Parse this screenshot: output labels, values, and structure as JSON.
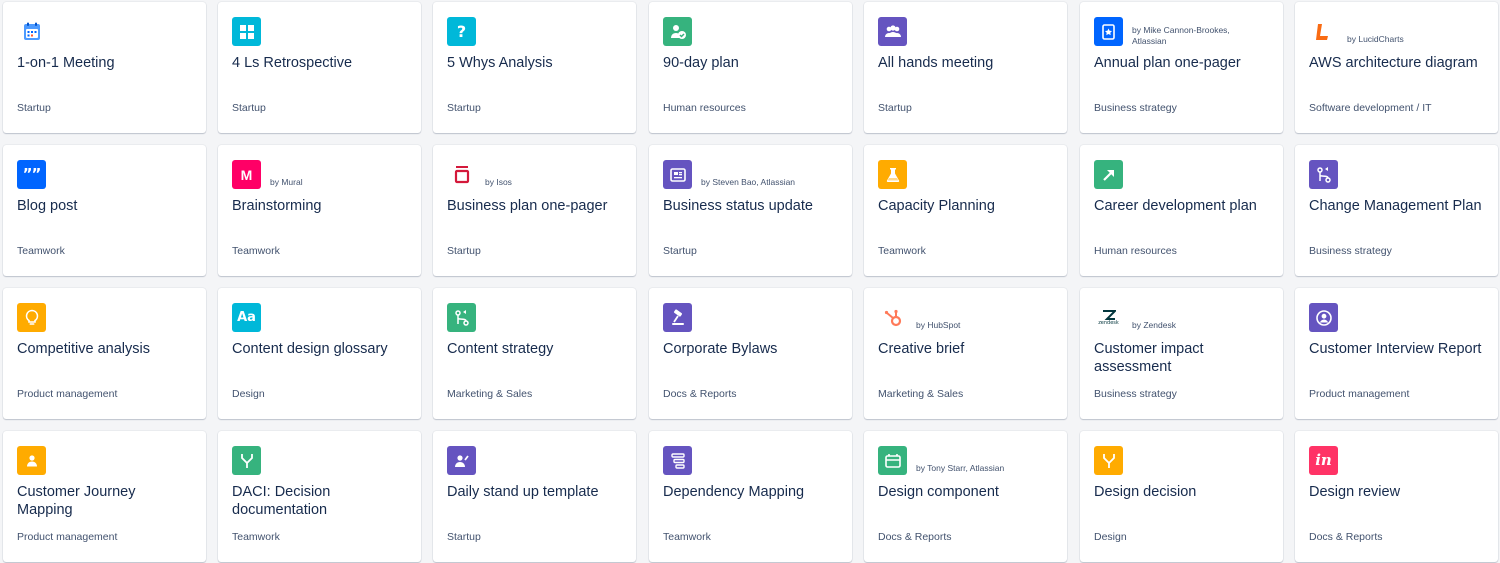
{
  "templates": [
    {
      "title": "1-on-1 Meeting",
      "category": "Startup",
      "icon": "calendar-icon",
      "color": "#ffffff",
      "author": ""
    },
    {
      "title": "4 Ls Retrospective",
      "category": "Startup",
      "icon": "grid-icon",
      "color": "#00b8d9",
      "author": ""
    },
    {
      "title": "5 Whys Analysis",
      "category": "Startup",
      "icon": "question-icon",
      "color": "#00b8d9",
      "author": ""
    },
    {
      "title": "90-day plan",
      "category": "Human resources",
      "icon": "person-check-icon",
      "color": "#36b37e",
      "author": ""
    },
    {
      "title": "All hands meeting",
      "category": "Startup",
      "icon": "people-icon",
      "color": "#6554c0",
      "author": ""
    },
    {
      "title": "Annual plan one-pager",
      "category": "Business strategy",
      "icon": "star-doc-icon",
      "color": "#0065ff",
      "author": "by Mike Cannon-Brookes, Atlassian"
    },
    {
      "title": "AWS architecture diagram",
      "category": "Software development / IT",
      "icon": "lucidcharts-logo-icon",
      "color": "#ffffff",
      "author": "by LucidCharts"
    },
    {
      "title": "Blog post",
      "category": "Teamwork",
      "icon": "quote-icon",
      "color": "#0065ff",
      "author": ""
    },
    {
      "title": "Brainstorming",
      "category": "Teamwork",
      "icon": "mural-logo-icon",
      "color": "#ff0066",
      "author": "by Mural"
    },
    {
      "title": "Business plan one-pager",
      "category": "Startup",
      "icon": "isos-logo-icon",
      "color": "#ffffff",
      "author": "by Isos"
    },
    {
      "title": "Business status update",
      "category": "Startup",
      "icon": "newspaper-icon",
      "color": "#6554c0",
      "author": "by Steven Bao, Atlassian"
    },
    {
      "title": "Capacity Planning",
      "category": "Teamwork",
      "icon": "flask-icon",
      "color": "#ffab00",
      "author": ""
    },
    {
      "title": "Career development plan",
      "category": "Human resources",
      "icon": "arrow-up-right-icon",
      "color": "#36b37e",
      "author": ""
    },
    {
      "title": "Change Management Plan",
      "category": "Business strategy",
      "icon": "branch-icon",
      "color": "#6554c0",
      "author": ""
    },
    {
      "title": "Competitive analysis",
      "category": "Product management",
      "icon": "lightbulb-icon",
      "color": "#ffab00",
      "author": ""
    },
    {
      "title": "Content design glossary",
      "category": "Design",
      "icon": "font-aa-icon",
      "color": "#00b8d9",
      "author": ""
    },
    {
      "title": "Content strategy",
      "category": "Marketing & Sales",
      "icon": "branch-icon",
      "color": "#36b37e",
      "author": ""
    },
    {
      "title": "Corporate Bylaws",
      "category": "Docs & Reports",
      "icon": "gavel-icon",
      "color": "#6554c0",
      "author": ""
    },
    {
      "title": "Creative brief",
      "category": "Marketing & Sales",
      "icon": "hubspot-logo-icon",
      "color": "#ffffff",
      "author": "by HubSpot"
    },
    {
      "title": "Customer impact assessment",
      "category": "Business strategy",
      "icon": "zendesk-logo-icon",
      "color": "#ffffff",
      "author": "by Zendesk"
    },
    {
      "title": "Customer Interview Report",
      "category": "Product management",
      "icon": "user-circle-icon",
      "color": "#6554c0",
      "author": ""
    },
    {
      "title": "Customer Journey Mapping",
      "category": "Product management",
      "icon": "person-icon",
      "color": "#ffab00",
      "author": ""
    },
    {
      "title": "DACI: Decision documentation",
      "category": "Teamwork",
      "icon": "fork-icon",
      "color": "#36b37e",
      "author": ""
    },
    {
      "title": "Daily stand up template",
      "category": "Startup",
      "icon": "person-edit-icon",
      "color": "#6554c0",
      "author": ""
    },
    {
      "title": "Dependency Mapping",
      "category": "Teamwork",
      "icon": "list-tree-icon",
      "color": "#6554c0",
      "author": ""
    },
    {
      "title": "Design component",
      "category": "Docs & Reports",
      "icon": "component-icon",
      "color": "#36b37e",
      "author": "by Tony Starr, Atlassian"
    },
    {
      "title": "Design decision",
      "category": "Design",
      "icon": "fork-icon",
      "color": "#ffab00",
      "author": ""
    },
    {
      "title": "Design review",
      "category": "Docs & Reports",
      "icon": "invision-logo-icon",
      "color": "#ff3366",
      "author": ""
    }
  ],
  "logo_text": {
    "mural": "M",
    "zendesk": "zendesk",
    "invision": "in",
    "aa": "Aa",
    "question": "?",
    "quote": "99"
  }
}
